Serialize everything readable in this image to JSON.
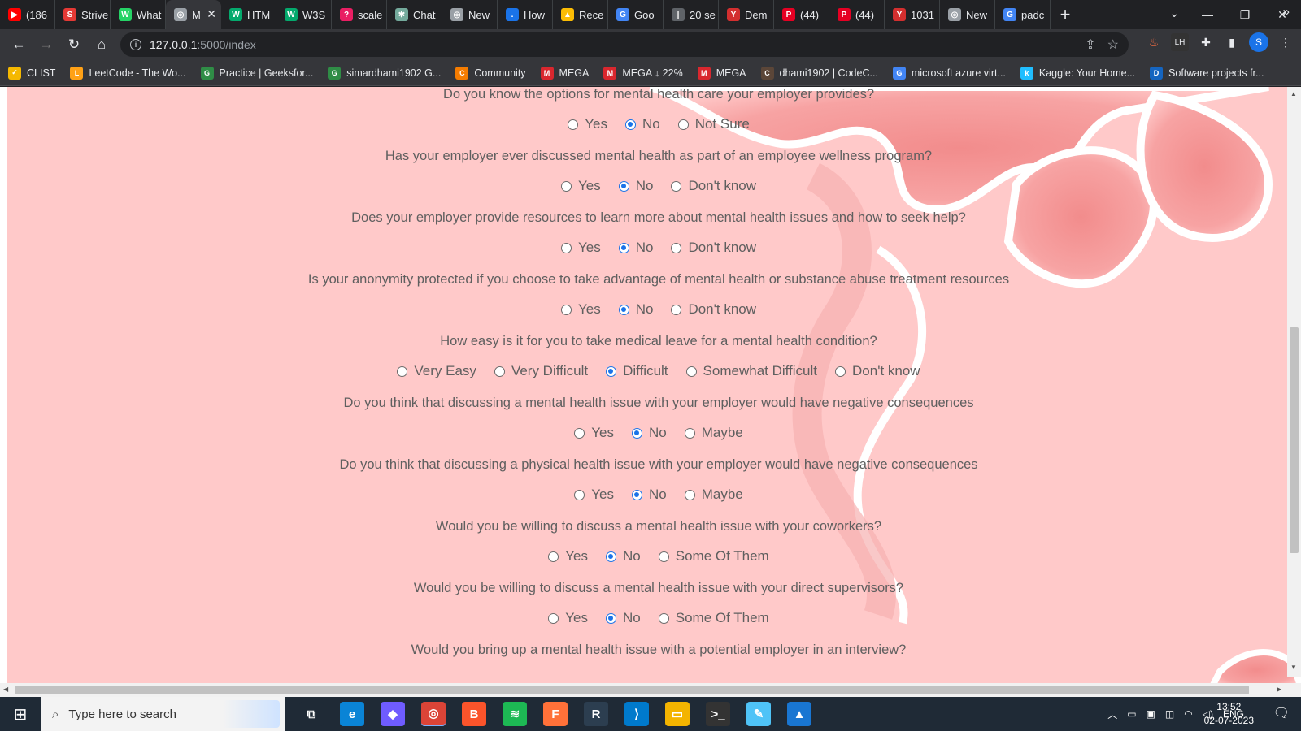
{
  "tabs": [
    {
      "title": "(186",
      "icon": "youtube-icon",
      "color": "#ff0000",
      "glyph": "▶"
    },
    {
      "title": "Strive",
      "icon": "striver-icon",
      "color": "#e53935",
      "glyph": "S"
    },
    {
      "title": "What",
      "icon": "whatsapp-icon",
      "color": "#25d366",
      "glyph": "W"
    },
    {
      "title": "M",
      "icon": "globe-icon",
      "color": "#9aa0a6",
      "glyph": "◎",
      "active": true
    },
    {
      "title": "HTM",
      "icon": "w3schools-icon",
      "color": "#04aa6d",
      "glyph": "W"
    },
    {
      "title": "W3S",
      "icon": "w3schools-icon",
      "color": "#04aa6d",
      "glyph": "W"
    },
    {
      "title": "scale",
      "icon": "scaler-icon",
      "color": "#e91e63",
      "glyph": "?"
    },
    {
      "title": "Chat",
      "icon": "chatgpt-icon",
      "color": "#74aa9c",
      "glyph": "✱"
    },
    {
      "title": "New",
      "icon": "globe-icon",
      "color": "#9aa0a6",
      "glyph": "◎"
    },
    {
      "title": "How",
      "icon": "dot-icon",
      "color": "#1a73e8",
      "glyph": "."
    },
    {
      "title": "Rece",
      "icon": "google-drive-icon",
      "color": "#fbbc04",
      "glyph": "▲"
    },
    {
      "title": "Goo",
      "icon": "google-lens-icon",
      "color": "#4285f4",
      "glyph": "G"
    },
    {
      "title": "20 se",
      "icon": "bar-icon",
      "color": "#5f6368",
      "glyph": "|"
    },
    {
      "title": "Dem",
      "icon": "scaler-icon",
      "color": "#d32f2f",
      "glyph": "Y"
    },
    {
      "title": "(44)",
      "icon": "pinterest-icon",
      "color": "#e60023",
      "glyph": "P"
    },
    {
      "title": "(44)",
      "icon": "pinterest-icon",
      "color": "#e60023",
      "glyph": "P"
    },
    {
      "title": "1031",
      "icon": "scaler-icon",
      "color": "#d32f2f",
      "glyph": "Y"
    },
    {
      "title": "New",
      "icon": "globe-icon",
      "color": "#9aa0a6",
      "glyph": "◎"
    },
    {
      "title": "padc",
      "icon": "google-icon",
      "color": "#4285f4",
      "glyph": "G"
    }
  ],
  "address": {
    "host": "127.0.0.1",
    "path": ":5000/index"
  },
  "bookmarks": [
    {
      "label": "CLIST",
      "icon": "clist-icon",
      "color": "#f5b800",
      "glyph": "✓"
    },
    {
      "label": "LeetCode - The Wo...",
      "icon": "leetcode-icon",
      "color": "#ffa116",
      "glyph": "L"
    },
    {
      "label": "Practice | Geeksfor...",
      "icon": "geeksforgeeks-icon",
      "color": "#2f8d46",
      "glyph": "G"
    },
    {
      "label": "simardhami1902 G...",
      "icon": "geeksforgeeks-icon",
      "color": "#2f8d46",
      "glyph": "G"
    },
    {
      "label": "Community",
      "icon": "community-icon",
      "color": "#f57c00",
      "glyph": "C"
    },
    {
      "label": "MEGA",
      "icon": "mega-icon",
      "color": "#d9272e",
      "glyph": "M"
    },
    {
      "label": "MEGA ↓ 22%",
      "icon": "mega-icon",
      "color": "#d9272e",
      "glyph": "M"
    },
    {
      "label": "MEGA",
      "icon": "mega-icon",
      "color": "#d9272e",
      "glyph": "M"
    },
    {
      "label": "dhami1902 | CodeC...",
      "icon": "codechef-icon",
      "color": "#5b4638",
      "glyph": "C"
    },
    {
      "label": "microsoft azure virt...",
      "icon": "google-icon",
      "color": "#4285f4",
      "glyph": "G"
    },
    {
      "label": "Kaggle: Your Home...",
      "icon": "kaggle-icon",
      "color": "#20beff",
      "glyph": "k"
    },
    {
      "label": "Software projects fr...",
      "icon": "software-icon",
      "color": "#1565c0",
      "glyph": "D"
    }
  ],
  "questions": [
    {
      "text": "Do you know the options for mental health care your employer provides?",
      "options": [
        "Yes",
        "No",
        "Not Sure"
      ],
      "selected": 1
    },
    {
      "text": "Has your employer ever discussed mental health as part of an employee wellness program?",
      "options": [
        "Yes",
        "No",
        "Don't know"
      ],
      "selected": 1
    },
    {
      "text": "Does your employer provide resources to learn more about mental health issues and how to seek help?",
      "options": [
        "Yes",
        "No",
        "Don't know"
      ],
      "selected": 1
    },
    {
      "text": "Is your anonymity protected if you choose to take advantage of mental health or substance abuse treatment resources",
      "options": [
        "Yes",
        "No",
        "Don't know"
      ],
      "selected": 1
    },
    {
      "text": "How easy is it for you to take medical leave for a mental health condition?",
      "options": [
        "Very Easy",
        "Very Difficult",
        "Difficult",
        "Somewhat Difficult",
        "Don't know"
      ],
      "selected": 2
    },
    {
      "text": "Do you think that discussing a mental health issue with your employer would have negative consequences",
      "options": [
        "Yes",
        "No",
        "Maybe"
      ],
      "selected": 1
    },
    {
      "text": "Do you think that discussing a physical health issue with your employer would have negative consequences",
      "options": [
        "Yes",
        "No",
        "Maybe"
      ],
      "selected": 1
    },
    {
      "text": "Would you be willing to discuss a mental health issue with your coworkers?",
      "options": [
        "Yes",
        "No",
        "Some Of Them"
      ],
      "selected": 1
    },
    {
      "text": "Would you be willing to discuss a mental health issue with your direct supervisors?",
      "options": [
        "Yes",
        "No",
        "Some Of Them"
      ],
      "selected": 1
    },
    {
      "text": "Would you bring up a mental health issue with a potential employer in an interview?",
      "options": [],
      "selected": -1
    }
  ],
  "taskbar": {
    "search_placeholder": "Type here to search",
    "apps": [
      {
        "icon": "task-view-icon",
        "color": "#1f2a36",
        "glyph": "⧉"
      },
      {
        "icon": "edge-icon",
        "color": "#0a84d6",
        "glyph": "e"
      },
      {
        "icon": "copilot-icon",
        "color": "#6f5cff",
        "glyph": "◆"
      },
      {
        "icon": "chrome-icon",
        "color": "#db4437",
        "glyph": "◎",
        "active": true
      },
      {
        "icon": "brave-icon",
        "color": "#fb542b",
        "glyph": "B"
      },
      {
        "icon": "spotify-icon",
        "color": "#1db954",
        "glyph": "≋"
      },
      {
        "icon": "firefox-icon",
        "color": "#ff7139",
        "glyph": "F"
      },
      {
        "icon": "rstudio-icon",
        "color": "#2c3e50",
        "glyph": "R"
      },
      {
        "icon": "vscode-icon",
        "color": "#007acc",
        "glyph": "⟩"
      },
      {
        "icon": "file-explorer-icon",
        "color": "#f4b400",
        "glyph": "▭"
      },
      {
        "icon": "terminal-icon",
        "color": "#333333",
        "glyph": ">_"
      },
      {
        "icon": "notepad-icon",
        "color": "#4fc3f7",
        "glyph": "✎"
      },
      {
        "icon": "photos-icon",
        "color": "#1976d2",
        "glyph": "▲"
      }
    ],
    "lang": "ENG",
    "time": "13:52",
    "date": "02-07-2023"
  }
}
